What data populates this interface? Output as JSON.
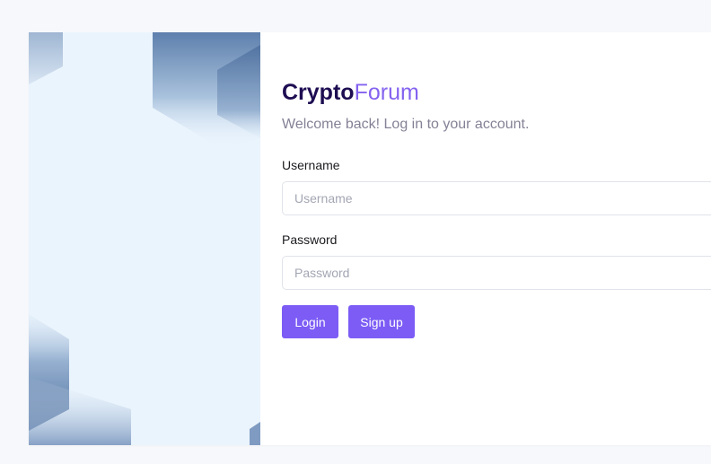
{
  "brand": {
    "name_bold": "Crypto",
    "name_light": "Forum"
  },
  "subtitle": "Welcome back! Log in to your account.",
  "form": {
    "username_label": "Username",
    "username_placeholder": "Username",
    "username_value": "",
    "password_label": "Password",
    "password_placeholder": "Password",
    "password_value": ""
  },
  "buttons": {
    "login": "Login",
    "signup": "Sign up"
  },
  "colors": {
    "accent": "#7c5cf5",
    "brand_dark": "#1e0d52",
    "brand_light": "#8463ef",
    "art_background": "#eaf4fd"
  }
}
